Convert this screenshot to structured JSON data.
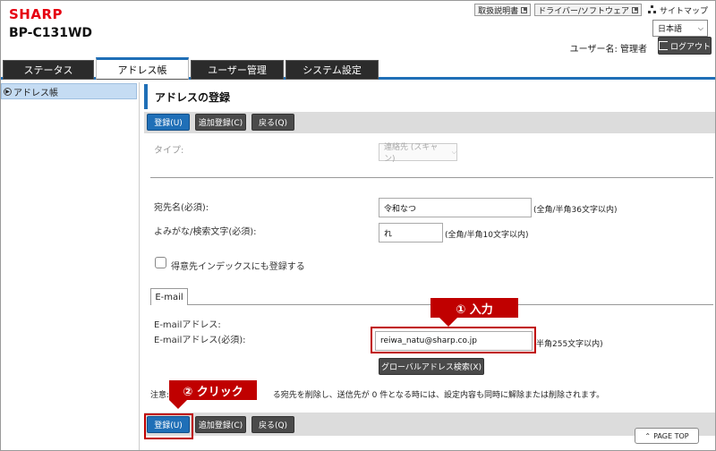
{
  "header": {
    "brand": "SHARP",
    "model": "BP-C131WD",
    "links": {
      "manual": "取扱説明書",
      "driver": "ドライバー/ソフトウェア",
      "sitemap": "サイトマップ"
    },
    "language": "日本語",
    "user_label": "ユーザー名: 管理者",
    "logout": "ログアウト"
  },
  "tabs": [
    "ステータス",
    "アドレス帳",
    "ユーザー管理",
    "システム設定"
  ],
  "sidebar": {
    "items": [
      {
        "label": "アドレス帳"
      }
    ]
  },
  "main": {
    "title": "アドレスの登録",
    "buttons": {
      "register": "登録(U)",
      "add_register": "追加登録(C)",
      "back": "戻る(Q)"
    },
    "type_label": "タイプ:",
    "type_value": "連絡先 (スキャン)",
    "name_label": "宛先名(必須):",
    "name_value": "令和なつ",
    "name_hint": "(全角/半角36文字以内)",
    "kana_label": "よみがな/検索文字(必須):",
    "kana_value": "れ",
    "kana_hint": "(全角/半角10文字以内)",
    "favorite_label": "得意先インデックスにも登録する",
    "email_tab": "E-mail",
    "email_label1": "E-mailアドレス:",
    "email_label2": "E-mailアドレス(必須):",
    "email_value": "reiwa_natu@sharp.co.jp",
    "email_hint": "半角255文字以内)",
    "global_search": "グローバルアドレス検索(X)",
    "note_prefix": "注意:",
    "note_suffix": "る宛先を削除し、送信先が 0 件となる時には、設定内容も同時に解除または削除されます。",
    "page_top": "PAGE TOP"
  },
  "callouts": {
    "input": "① 入力",
    "click": "② クリック"
  },
  "colors": {
    "accent": "#1f6fb7",
    "callout": "#c00000",
    "brand": "#e60012"
  }
}
